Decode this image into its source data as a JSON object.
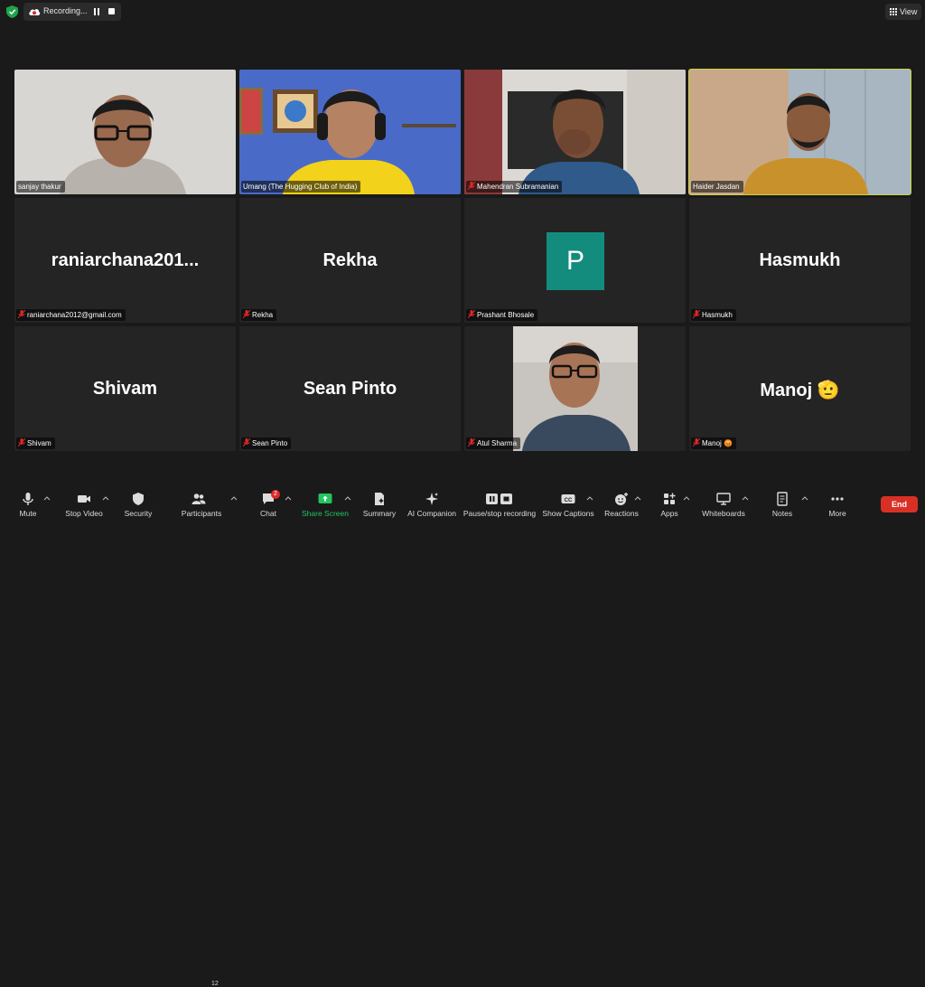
{
  "top_bar": {
    "recording_label": "Recording...",
    "view_label": "View"
  },
  "tiles": [
    {
      "name_tag": "sanjay thakur"
    },
    {
      "name_tag": "Umang (The Hugging Club of India)"
    },
    {
      "name_tag": "Mahendran Subramanian"
    },
    {
      "name_tag": "Haider Jasdan"
    },
    {
      "display_name": "raniarchana201...",
      "name_tag": "raniarchana2012@gmail.com"
    },
    {
      "display_name": "Rekha",
      "name_tag": "Rekha"
    },
    {
      "avatar_letter": "P",
      "name_tag": "Prashant Bhosale"
    },
    {
      "display_name": "Hasmukh",
      "name_tag": "Hasmukh"
    },
    {
      "display_name": "Shivam",
      "name_tag": "Shivam"
    },
    {
      "display_name": "Sean Pinto",
      "name_tag": "Sean Pinto"
    },
    {
      "name_tag": "Atul Sharma"
    },
    {
      "display_name": "Manoj 🫡",
      "name_tag": "Manoj 😡"
    }
  ],
  "toolbar": {
    "mute": "Mute",
    "stop_video": "Stop Video",
    "security": "Security",
    "participants": "Participants",
    "participants_count": "12",
    "chat": "Chat",
    "chat_badge": "2",
    "share_screen": "Share Screen",
    "summary": "Summary",
    "ai_companion": "AI Companion",
    "pause_stop_recording": "Pause/stop recording",
    "show_captions": "Show Captions",
    "reactions": "Reactions",
    "apps": "Apps",
    "whiteboards": "Whiteboards",
    "notes": "Notes",
    "more": "More",
    "end": "End"
  },
  "colors": {
    "active_speaker_border": "#c9d54a",
    "avatar_bg": "#138c7d",
    "end_button": "#d93025",
    "share_screen": "#22c55e",
    "muted_mic": "#e02828"
  }
}
